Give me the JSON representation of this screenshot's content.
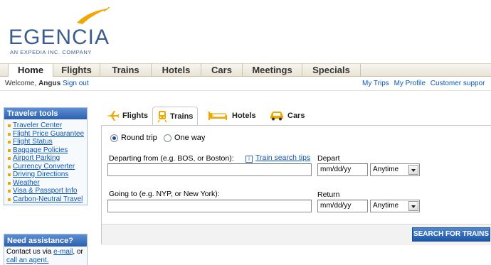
{
  "brand": {
    "name": "EGENCIA",
    "tagline": "AN EXPEDIA INC. COMPANY",
    "accent_color": "#3a5d8f",
    "swoosh_color": "#f0a800"
  },
  "nav": {
    "items": [
      {
        "label": "Home",
        "active": true
      },
      {
        "label": "Flights"
      },
      {
        "label": "Trains"
      },
      {
        "label": "Hotels"
      },
      {
        "label": "Cars"
      },
      {
        "label": "Meetings"
      },
      {
        "label": "Specials"
      }
    ]
  },
  "welcome": {
    "prefix": "Welcome,",
    "user": "Angus",
    "sign_out": "Sign out"
  },
  "toplinks": [
    "My Trips",
    "My Profile",
    "Customer suppor"
  ],
  "traveler_tools": {
    "title": "Traveler tools",
    "items": [
      "Traveler Center",
      "Flight Price Guarantee",
      "Flight Status",
      "Baggage Policies",
      "Airport Parking",
      "Currency Converter",
      "Driving Directions",
      "Weather",
      "Visa & Passport Info",
      "Carbon-Neutral Travel"
    ]
  },
  "assistance": {
    "title": "Need assistance?",
    "line1_prefix": "Contact us via",
    "email_link": "e-mail",
    "line1_suffix": ", or",
    "call_link": "call an agent."
  },
  "tabs": [
    {
      "label": "Flights",
      "icon": "plane-icon"
    },
    {
      "label": "Trains",
      "icon": "train-icon",
      "active": true
    },
    {
      "label": "Hotels",
      "icon": "bed-icon"
    },
    {
      "label": "Cars",
      "icon": "car-icon"
    }
  ],
  "trip_type": {
    "round_trip": "Round trip",
    "one_way": "One way",
    "selected": "Round trip"
  },
  "form": {
    "departing_label": "Departing from (e.g. BOS, or Boston):",
    "train_tips": "Train search tips",
    "depart_label": "Depart",
    "depart_date": "mm/dd/yy",
    "depart_time": "Anytime",
    "going_label": "Going to (e.g. NYP, or New York):",
    "return_label": "Return",
    "return_date": "mm/dd/yy",
    "return_time": "Anytime",
    "departing_value": "",
    "going_value": ""
  },
  "search_button": "SEARCH FOR TRAINS"
}
